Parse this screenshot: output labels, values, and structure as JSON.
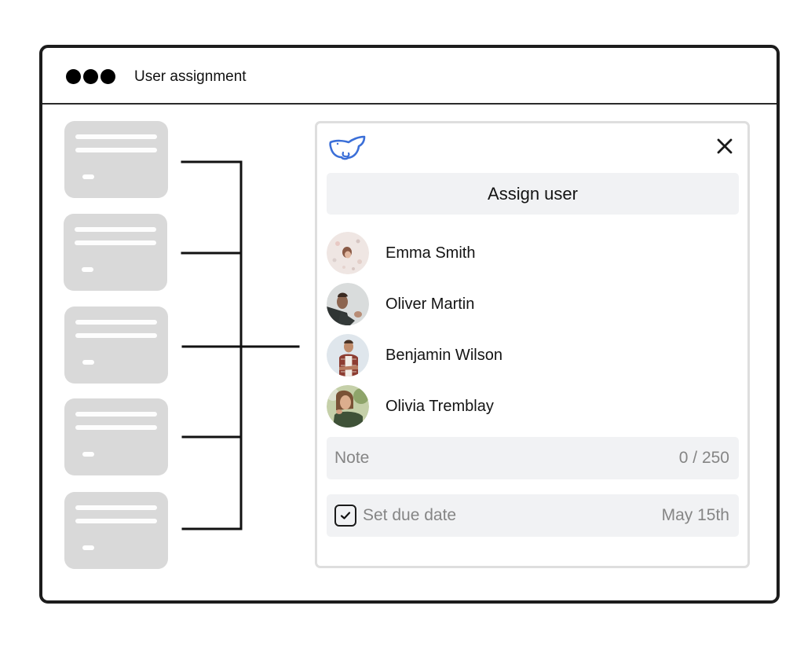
{
  "window": {
    "title": "User assignment",
    "controls": [
      "dot",
      "dot",
      "dot"
    ]
  },
  "task_cards": [
    {
      "id": 1,
      "connected": true
    },
    {
      "id": 2,
      "connected": true
    },
    {
      "id": 3,
      "connected": true
    },
    {
      "id": 4,
      "connected": true
    },
    {
      "id": 5,
      "connected": true
    }
  ],
  "panel": {
    "logo_icon": "whale-icon",
    "close_icon": "close-icon",
    "title": "Assign user",
    "users": [
      {
        "name": "Emma Smith",
        "avatar": "photo-emma"
      },
      {
        "name": "Oliver Martin",
        "avatar": "photo-oliver"
      },
      {
        "name": "Benjamin Wilson",
        "avatar": "photo-benjamin"
      },
      {
        "name": "Olivia Tremblay",
        "avatar": "photo-olivia"
      }
    ],
    "note": {
      "placeholder": "Note",
      "counter": "0 / 250"
    },
    "due_date": {
      "label": "Set due date",
      "checked": true,
      "value": "May 15th"
    }
  },
  "colors": {
    "accent": "#3b6fd8",
    "frame": "#1c1c1c",
    "card": "#d9d9d9",
    "field_bg": "#f1f2f4"
  }
}
